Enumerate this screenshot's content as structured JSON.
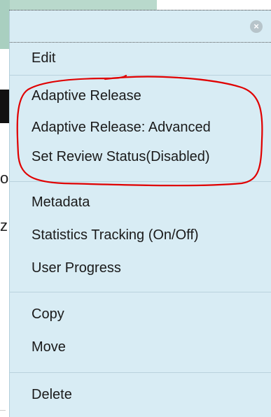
{
  "menu": {
    "close_glyph": "×",
    "groups": [
      {
        "items": [
          "Edit"
        ]
      },
      {
        "items": [
          "Adaptive Release",
          "Adaptive Release: Advanced",
          "Set Review Status(Disabled)"
        ]
      },
      {
        "items": [
          "Metadata",
          "Statistics Tracking (On/Off)",
          "User Progress"
        ]
      },
      {
        "items": [
          "Copy",
          "Move"
        ]
      },
      {
        "items": [
          "Delete"
        ]
      }
    ]
  },
  "background": {
    "fragment_1": "o",
    "fragment_2": "z"
  },
  "colors": {
    "menu_bg": "#d8ecf4",
    "annotation": "#e00000"
  }
}
